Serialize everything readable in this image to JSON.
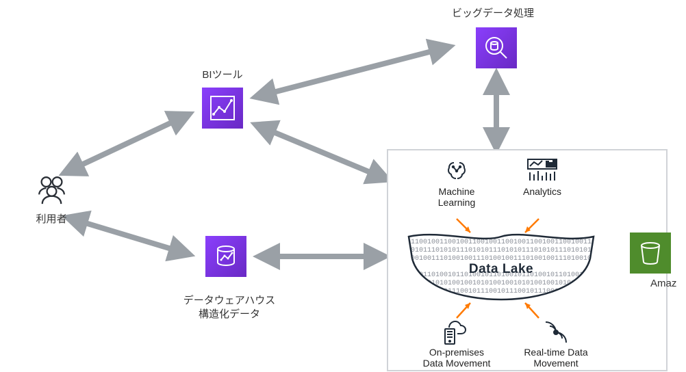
{
  "labels": {
    "users": "利用者",
    "bi_tool": "BIツール",
    "big_data": "ビッグデータ処理",
    "dwh_line1": "データウェアハウス",
    "dwh_line2": "構造化データ",
    "s3_label": "Amaz",
    "dl_ml": "Machine\nLearning",
    "dl_analytics": "Analytics",
    "dl_onprem": "On-premises\nData Movement",
    "dl_realtime": "Real-time Data\nMovement",
    "dl_title": "Data Lake"
  },
  "colors": {
    "tile_purple_a": "#8a3ffc",
    "tile_purple_b": "#6929c4",
    "tile_green": "#4f8c2c",
    "arrow_gray": "#9aa0a6",
    "arrow_orange": "#ff7a00",
    "lake_stroke": "#1f2a37",
    "text": "#333"
  }
}
